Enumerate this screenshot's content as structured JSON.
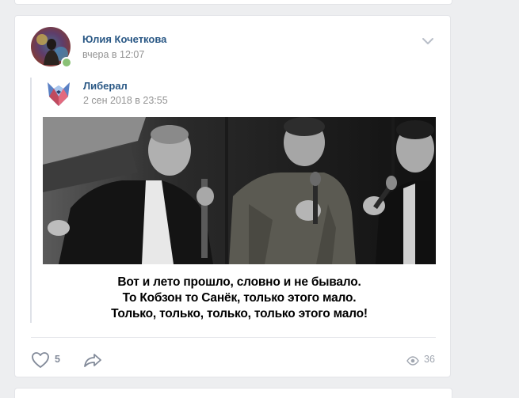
{
  "post": {
    "author_name": "Юлия Кочеткова",
    "date": "вчера в 12:07",
    "more_icon": "chevron-down-icon",
    "repost": {
      "source_name": "Либерал",
      "source_date": "2 сен 2018 в 23:55",
      "image_caption": [
        "Вот и лето прошло, словно и не бывало.",
        "То Кобзон то Санёк, только этого мало.",
        "Только, только, только, только этого мало!"
      ]
    },
    "footer": {
      "like_icon": "heart-icon",
      "likes": "5",
      "share_icon": "share-arrow-icon",
      "views_icon": "eye-icon",
      "views": "36"
    }
  },
  "colors": {
    "link": "#2a5885",
    "muted": "#939393",
    "background": "#edeef0",
    "online": "#8ac176"
  }
}
